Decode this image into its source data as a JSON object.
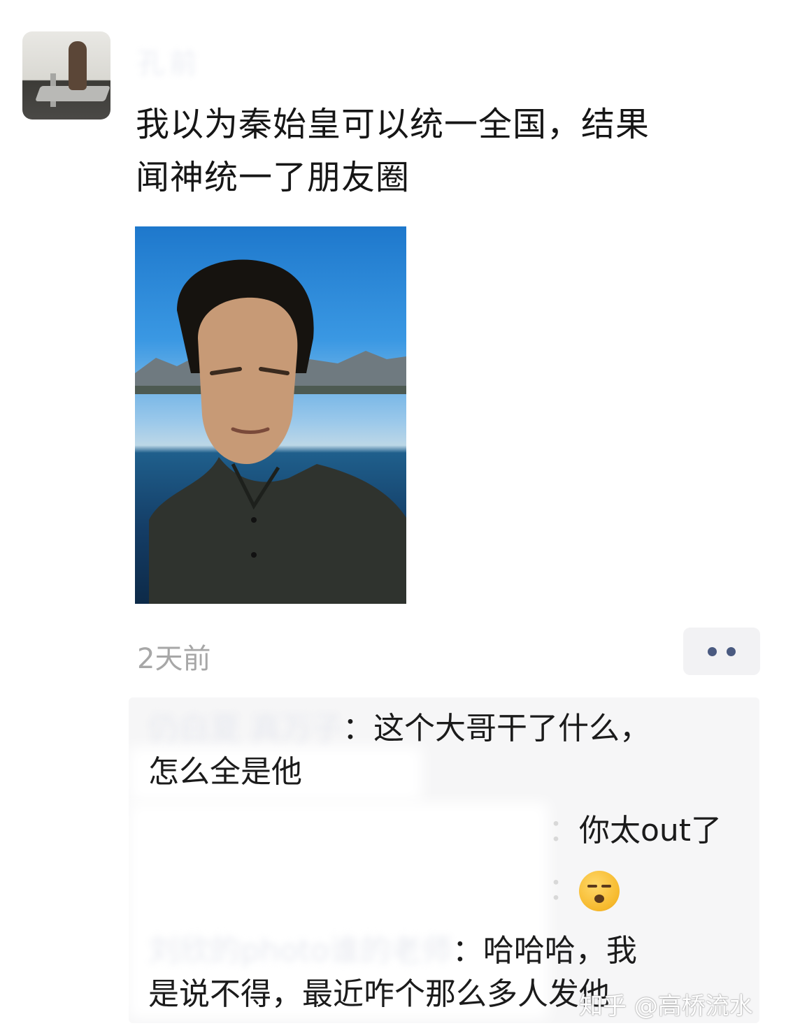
{
  "post": {
    "author": "孔前",
    "text_line1": "我以为秦始皇可以统一全国，结果",
    "text_line2": "闻神统一了朋友圈",
    "timestamp": "2天前",
    "more_icon": "ellipsis-icon"
  },
  "comments": [
    {
      "name": "仍白夏 真万子",
      "text_line1": "这个大哥干了什么，",
      "text_line2": "怎么全是他"
    },
    {
      "name": "",
      "text": "你太out了"
    },
    {
      "name": "",
      "emoji": "kiss-face-icon"
    },
    {
      "name": "刘欣的photo谁的老师",
      "text_line1": "哈哈哈，我",
      "text_line2": "是说不得，最近咋个那么多人发他"
    }
  ],
  "watermark": "知乎 @高桥流水",
  "colors": {
    "timestamp": "#a7a7a7",
    "comment_bg": "#f6f6f7",
    "dots": "#4a5a80"
  }
}
